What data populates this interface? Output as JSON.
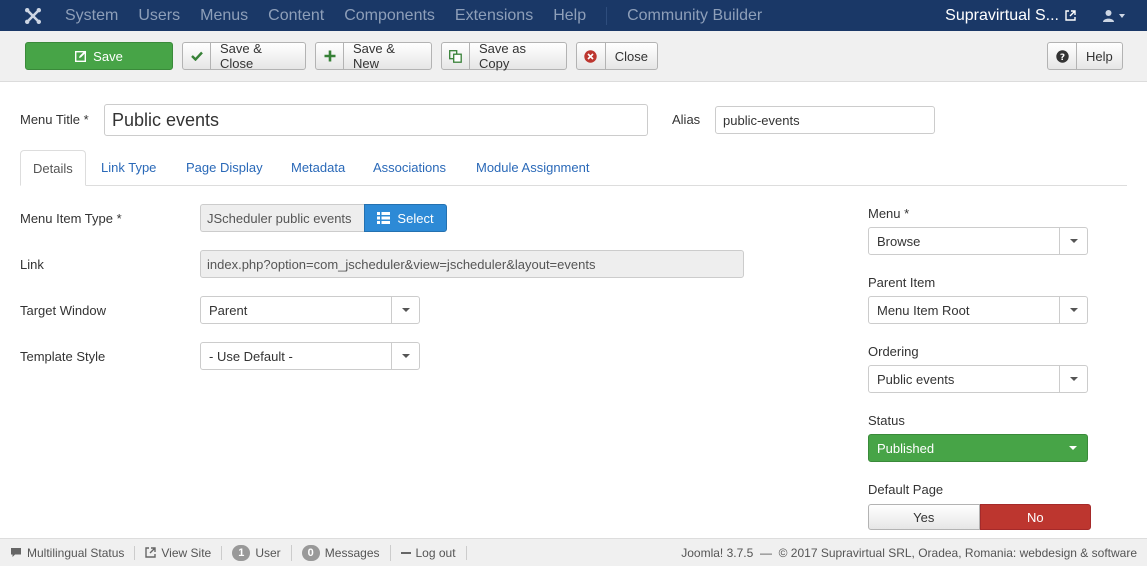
{
  "navbar": {
    "menu": [
      "System",
      "Users",
      "Menus",
      "Content",
      "Components",
      "Extensions",
      "Help"
    ],
    "extra": "Community Builder",
    "site_name": "Supravirtual S..."
  },
  "toolbar": {
    "save": "Save",
    "save_close": "Save & Close",
    "save_new": "Save & New",
    "save_copy": "Save as Copy",
    "close": "Close",
    "help": "Help"
  },
  "title_row": {
    "menu_title_label": "Menu Title *",
    "menu_title_value": "Public events",
    "alias_label": "Alias",
    "alias_value": "public-events"
  },
  "tabs": [
    "Details",
    "Link Type",
    "Page Display",
    "Metadata",
    "Associations",
    "Module Assignment"
  ],
  "details": {
    "menu_item_type_label": "Menu Item Type *",
    "menu_item_type_value": "JScheduler public events",
    "select_label": "Select",
    "link_label": "Link",
    "link_value": "index.php?option=com_jscheduler&view=jscheduler&layout=events",
    "target_window_label": "Target Window",
    "target_window_value": "Parent",
    "template_style_label": "Template Style",
    "template_style_value": "- Use Default -"
  },
  "side": {
    "menu_label": "Menu *",
    "menu_value": "Browse",
    "parent_label": "Parent Item",
    "parent_value": "Menu Item Root",
    "ordering_label": "Ordering",
    "ordering_value": "Public events",
    "status_label": "Status",
    "status_value": "Published",
    "default_label": "Default Page",
    "yes": "Yes",
    "no": "No"
  },
  "statusbar": {
    "multilingual": "Multilingual Status",
    "view_site": "View Site",
    "user_count": "1",
    "user_label": "User",
    "messages_count": "0",
    "messages_label": "Messages",
    "logout": "Log out",
    "footer": "Joomla! 3.7.5  —  © 2017 Supravirtual SRL, Oradea, Romania: webdesign & software"
  },
  "colors": {
    "navbar": "#1a3867",
    "save": "#47a447",
    "select_button": "#2d8ad6",
    "no_active": "#bd362f"
  }
}
